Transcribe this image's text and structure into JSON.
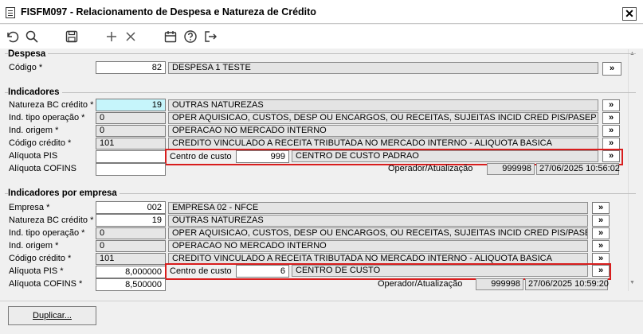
{
  "window": {
    "title": "FISFM097 - Relacionamento de Despesa e Natureza de Crédito",
    "close_glyph": "✕"
  },
  "toolbar": {
    "icons": [
      "undo-icon",
      "search-icon",
      "save-icon",
      "add-icon",
      "delete-icon",
      "calendar-icon",
      "help-icon",
      "exit-icon"
    ]
  },
  "despesa": {
    "section_title": "Despesa",
    "codigo_label": "Código *",
    "codigo_value": "82",
    "codigo_desc": "DESPESA 1 TESTE"
  },
  "indicadores": {
    "section_title": "Indicadores",
    "natureza_label": "Natureza BC crédito *",
    "natureza_value": "19",
    "natureza_desc": "OUTRAS NATUREZAS",
    "tipo_op_label": "Ind. tipo operação *",
    "tipo_op_value": "0",
    "tipo_op_desc": "OPER AQUISICAO, CUSTOS, DESP OU ENCARGOS, OU RECEITAS, SUJEITAS INCID CRED PIS/PASEP OU COFINS",
    "origem_label": "Ind. origem *",
    "origem_value": "0",
    "origem_desc": "OPERACAO NO MERCADO INTERNO",
    "cod_credito_label": "Código crédito *",
    "cod_credito_value": "101",
    "cod_credito_desc": "CREDITO VINCULADO A RECEITA TRIBUTADA NO MERCADO INTERNO - ALIQUOTA BASICA",
    "aliq_pis_label": "Alíquota PIS",
    "aliq_pis_value": "",
    "aliq_cofins_label": "Alíquota COFINS",
    "aliq_cofins_value": "",
    "centro_label": "Centro de custo",
    "centro_value": "999",
    "centro_desc": "CENTRO DE CUSTO PADRAO",
    "operador_label": "Operador/Atualização",
    "operador_value": "999998",
    "atualizacao_value": "27/06/2025 10:56:02"
  },
  "por_empresa": {
    "section_title": "Indicadores por empresa",
    "empresa_label": "Empresa *",
    "empresa_value": "002",
    "empresa_desc": "EMPRESA 02 - NFCE",
    "natureza_label": "Natureza BC crédito *",
    "natureza_value": "19",
    "natureza_desc": "OUTRAS NATUREZAS",
    "tipo_op_label": "Ind. tipo operação *",
    "tipo_op_value": "0",
    "tipo_op_desc": "OPER AQUISICAO, CUSTOS, DESP OU ENCARGOS, OU RECEITAS, SUJEITAS INCID CRED PIS/PASEP OU COF",
    "origem_label": "Ind. origem *",
    "origem_value": "0",
    "origem_desc": "OPERACAO NO MERCADO INTERNO",
    "cod_credito_label": "Código crédito *",
    "cod_credito_value": "101",
    "cod_credito_desc": "CREDITO VINCULADO A RECEITA TRIBUTADA NO MERCADO INTERNO - ALIQUOTA BASICA",
    "aliq_pis_label": "Alíquota PIS *",
    "aliq_pis_value": "8,000000",
    "aliq_cofins_label": "Alíquota COFINS *",
    "aliq_cofins_value": "8,500000",
    "centro_label": "Centro de custo",
    "centro_value": "6",
    "centro_desc": "CENTRO DE CUSTO",
    "operador_label": "Operador/Atualização",
    "operador_value": "999998",
    "atualizacao_value": "27/06/2025 10:59:20"
  },
  "lookup_label": "»",
  "duplicar_label": "Duplicar...",
  "colors": {
    "highlight_field": "#c6f5fb",
    "red_box": "#d81d1d"
  }
}
